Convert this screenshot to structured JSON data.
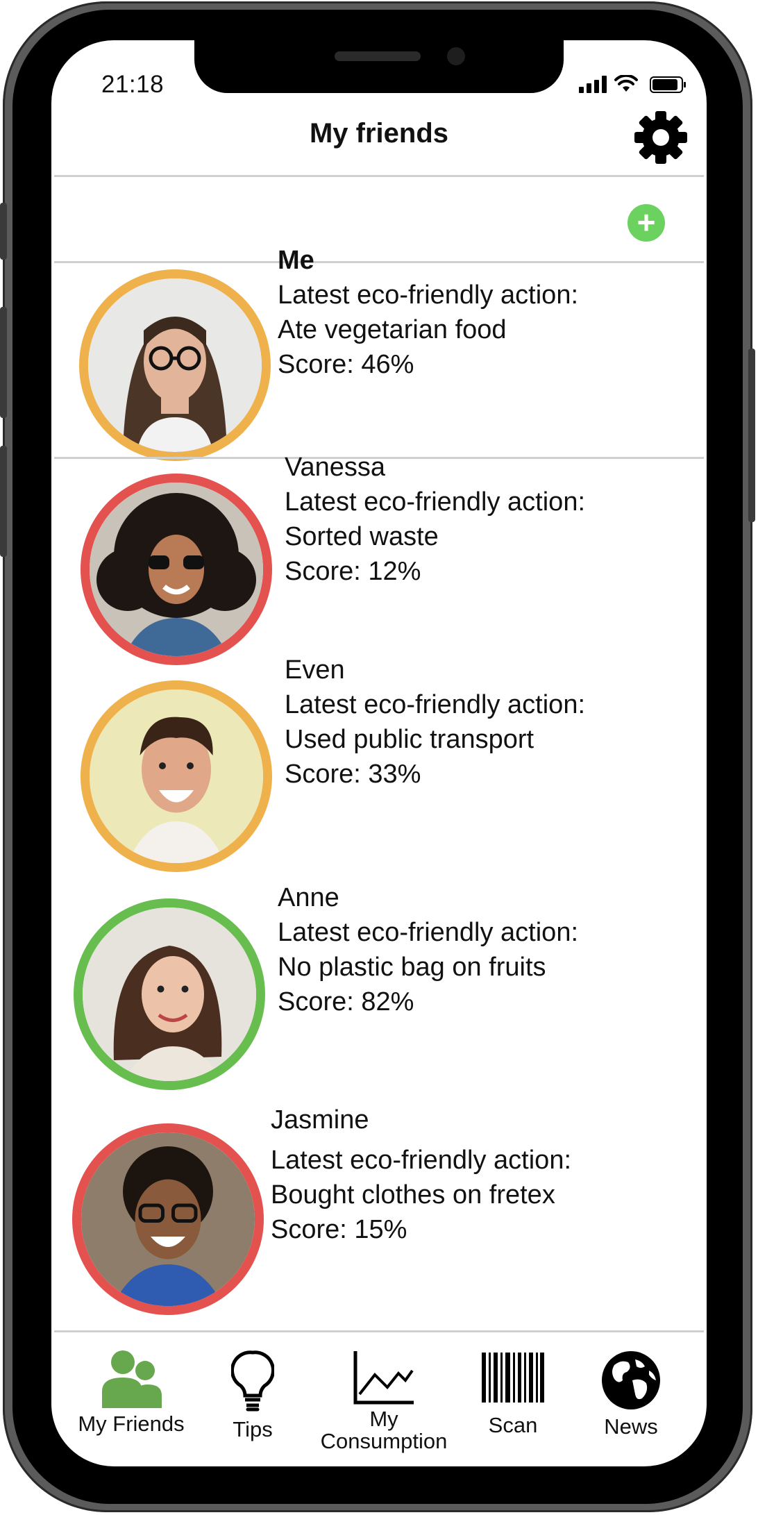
{
  "status_bar": {
    "time": "21:18"
  },
  "header": {
    "title": "My friends"
  },
  "icons": {
    "settings": "gear-icon",
    "add": "plus-icon",
    "friends": "people-icon",
    "tips": "lightbulb-icon",
    "consumption": "line-chart-icon",
    "scan": "barcode-icon",
    "news": "globe-icon"
  },
  "add_button": {
    "symbol": "+"
  },
  "friends": [
    {
      "name": "Me",
      "action_label": "Latest eco-friendly action:",
      "action": "Ate vegetarian food",
      "score": "Score: 46%",
      "ring_color": "#efb14b"
    },
    {
      "name": "Vanessa",
      "action_label": "Latest eco-friendly action:",
      "action": "Sorted waste",
      "score": "Score: 12%",
      "ring_color": "#e4524f"
    },
    {
      "name": "Even",
      "action_label": "Latest eco-friendly action:",
      "action": "Used public transport",
      "score": "Score: 33%",
      "ring_color": "#efb14b"
    },
    {
      "name": "Anne",
      "action_label": "Latest eco-friendly action:",
      "action": "No plastic bag on fruits",
      "score": "Score: 82%",
      "ring_color": "#67be4f"
    },
    {
      "name": "Jasmine",
      "action_label": "Latest eco-friendly action:",
      "action": "Bought clothes on fretex",
      "score": "Score: 15%",
      "ring_color": "#e4524f"
    }
  ],
  "tabbar": {
    "friends": "My Friends",
    "tips": "Tips",
    "consumption_line1": "My",
    "consumption_line2": "Consumption",
    "scan": "Scan",
    "news": "News",
    "active_color": "#67a84f"
  }
}
